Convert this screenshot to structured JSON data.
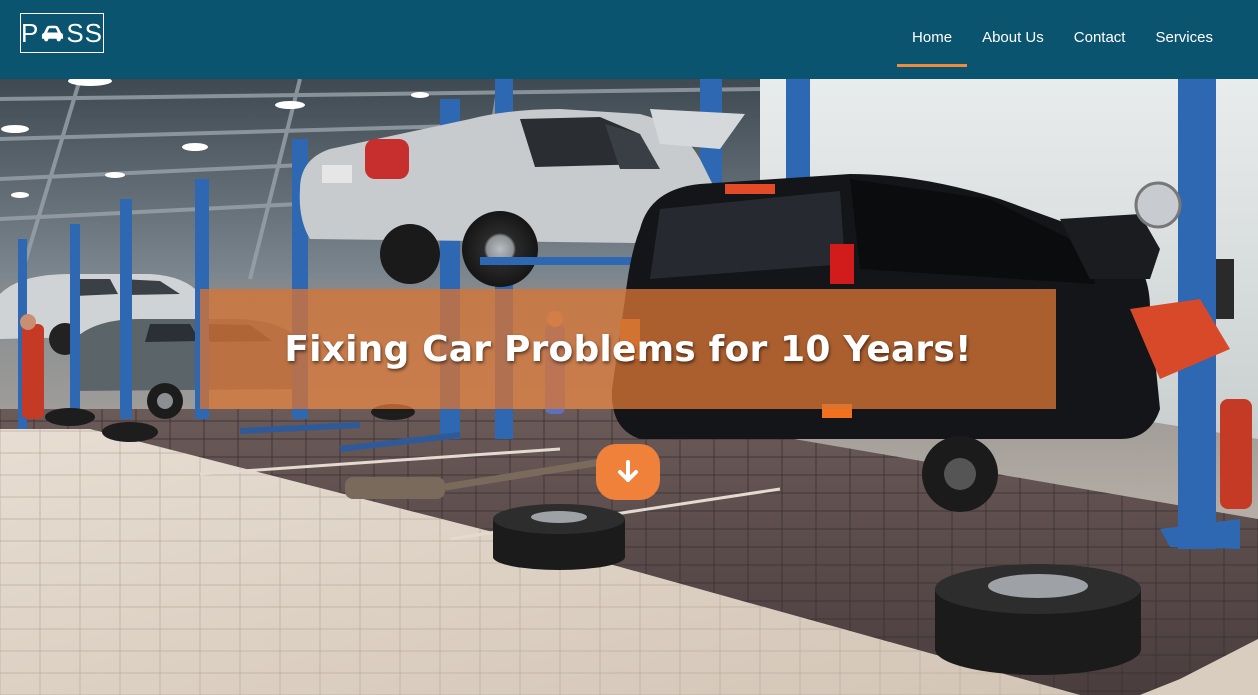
{
  "logo": {
    "text_prefix": "P",
    "text_suffix": "SS",
    "icon": "car-icon"
  },
  "nav": {
    "items": [
      {
        "label": "Home",
        "active": true
      },
      {
        "label": "About Us",
        "active": false
      },
      {
        "label": "Contact",
        "active": false
      },
      {
        "label": "Services",
        "active": false
      }
    ]
  },
  "hero": {
    "title": "Fixing Car Problems for 10 Years!",
    "scroll_icon": "arrow-down-icon"
  },
  "colors": {
    "navbar": "#0b5470",
    "accent": "#f08a3c",
    "banner": "#d67436",
    "text": "#ffffff"
  }
}
